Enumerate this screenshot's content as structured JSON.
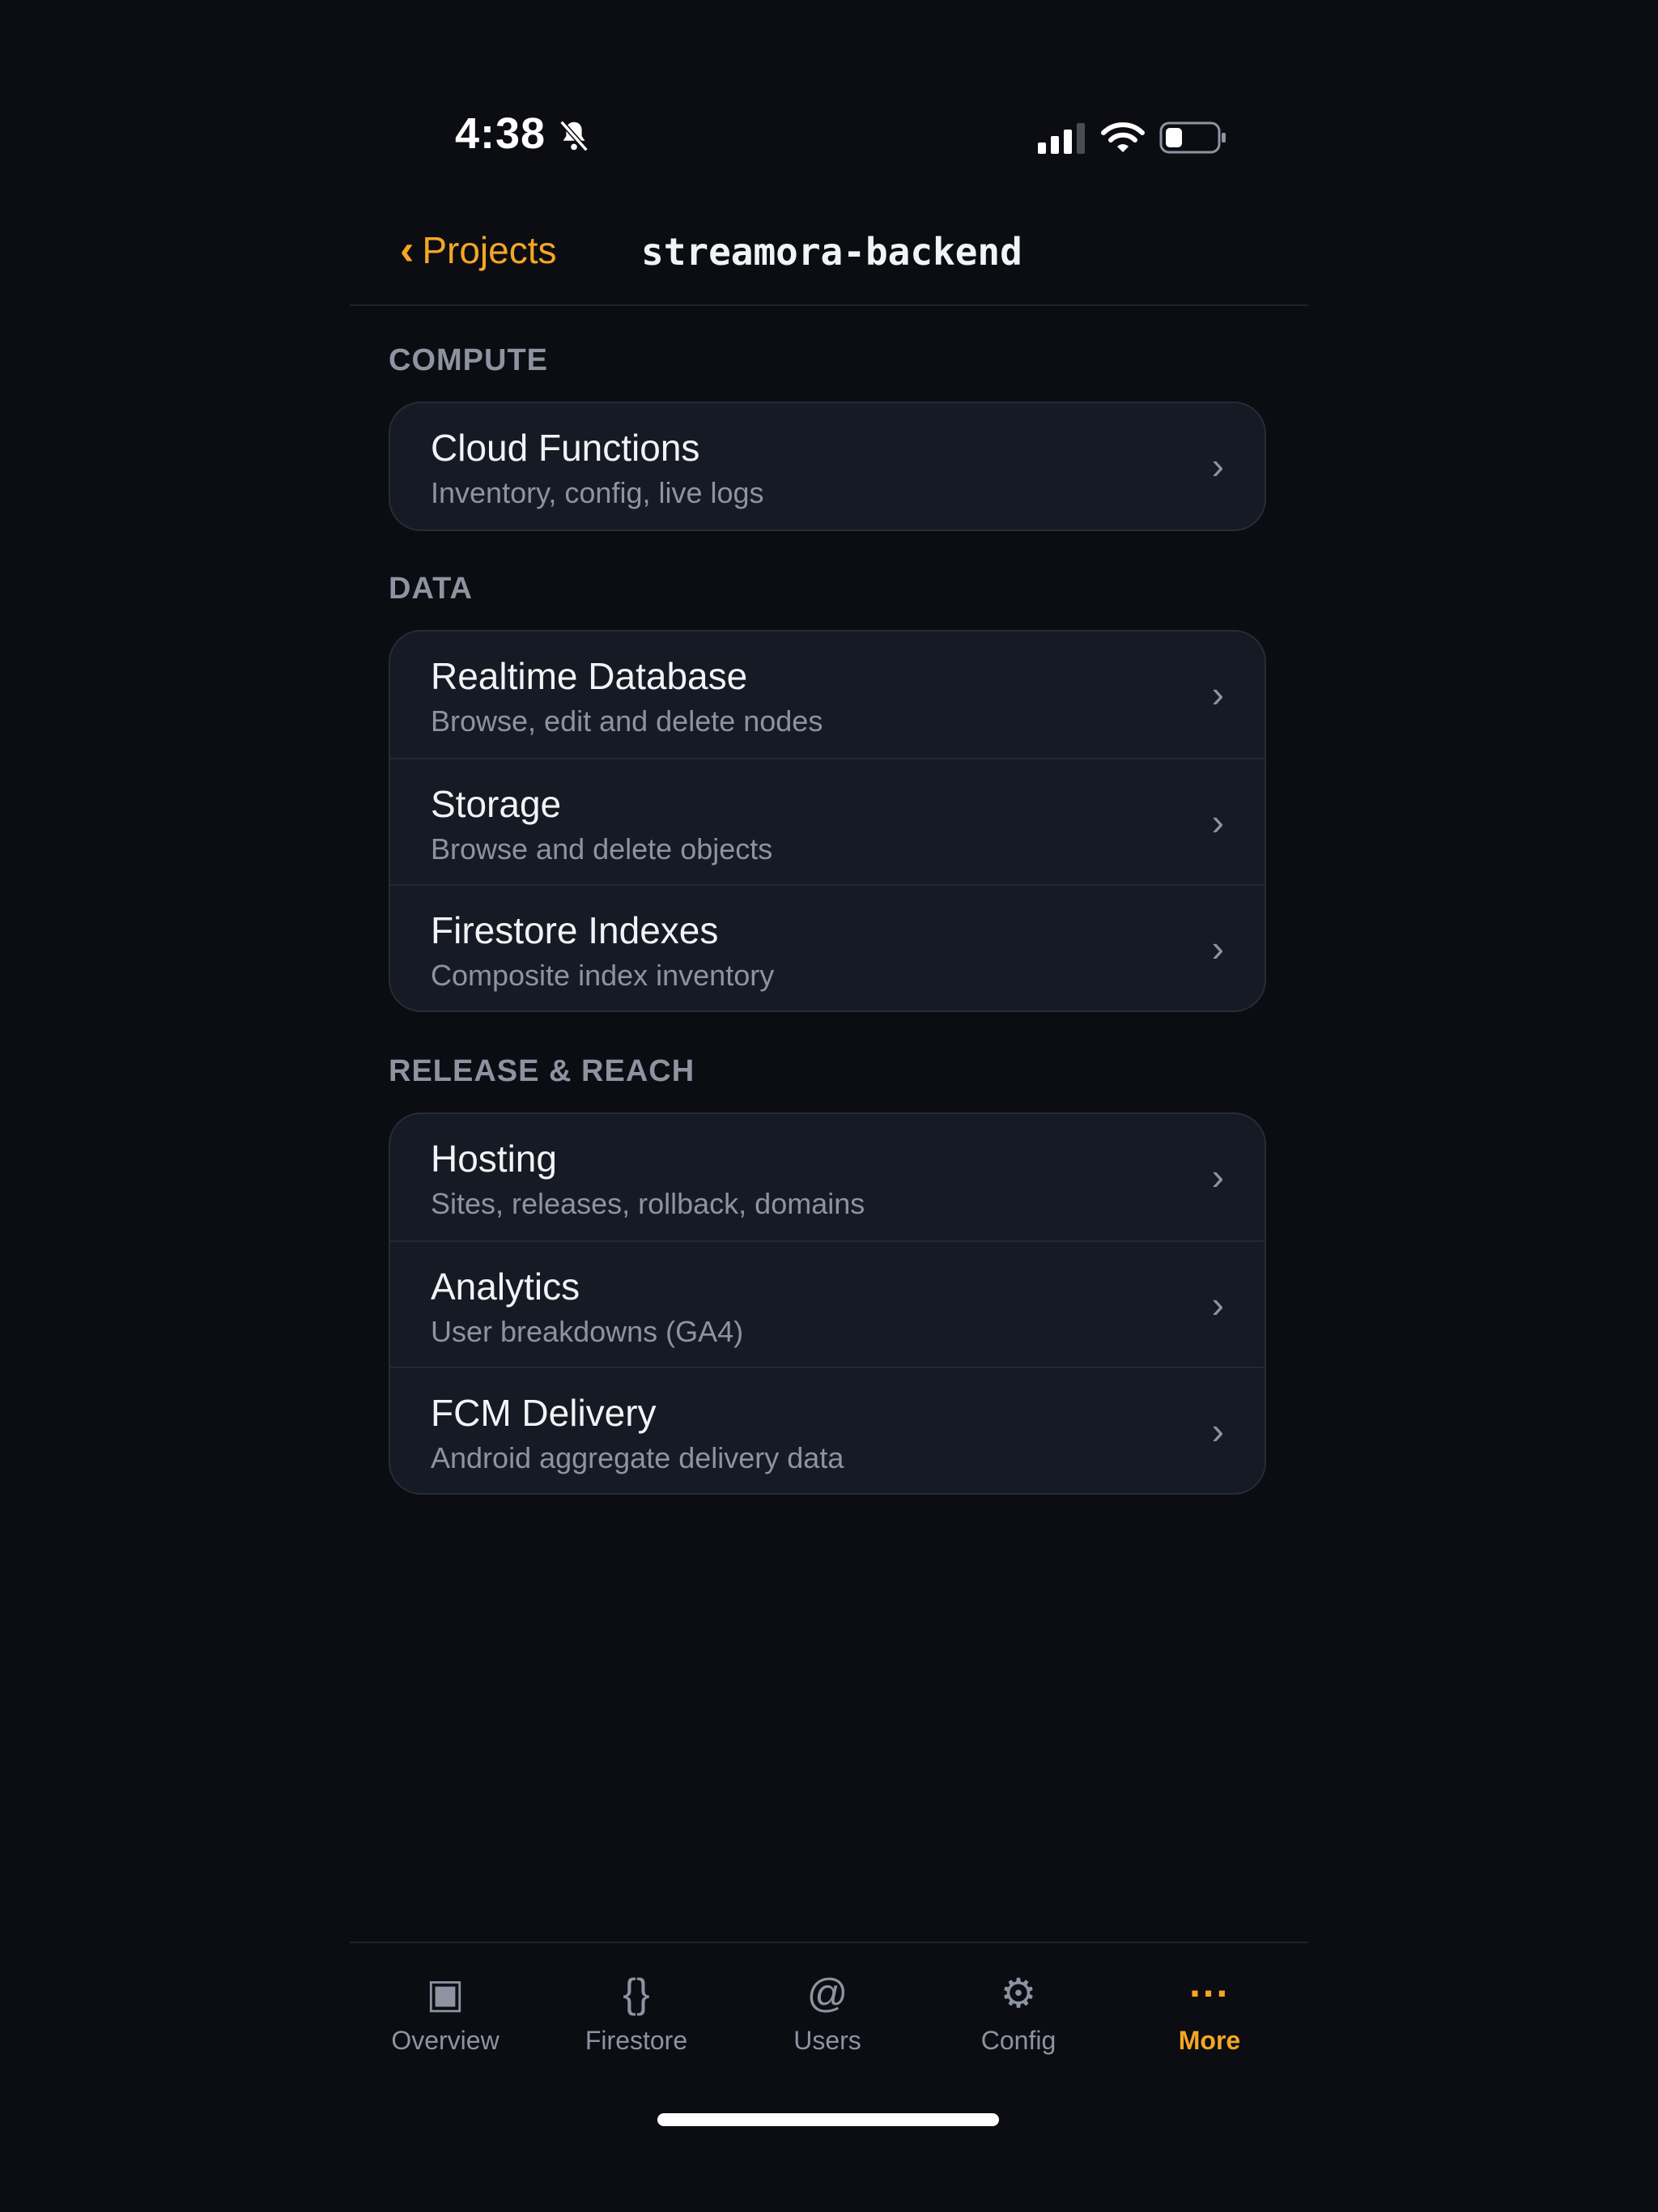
{
  "status_bar": {
    "time": "4:38",
    "icons": [
      "bell-slash-icon",
      "cellular-signal-icon",
      "wifi-icon",
      "battery-icon"
    ]
  },
  "nav": {
    "back_label": "Projects",
    "title": "streamora-backend"
  },
  "sections": [
    {
      "header": "COMPUTE",
      "items": [
        {
          "title": "Cloud Functions",
          "subtitle": "Inventory, config, live logs"
        }
      ]
    },
    {
      "header": "DATA",
      "items": [
        {
          "title": "Realtime Database",
          "subtitle": "Browse, edit and delete nodes"
        },
        {
          "title": "Storage",
          "subtitle": "Browse and delete objects"
        },
        {
          "title": "Firestore Indexes",
          "subtitle": "Composite index inventory"
        }
      ]
    },
    {
      "header": "RELEASE & REACH",
      "items": [
        {
          "title": "Hosting",
          "subtitle": "Sites, releases, rollback, domains"
        },
        {
          "title": "Analytics",
          "subtitle": "User breakdowns (GA4)"
        },
        {
          "title": "FCM Delivery",
          "subtitle": "Android aggregate delivery data"
        }
      ]
    }
  ],
  "tabs": [
    {
      "label": "Overview",
      "icon": "▣",
      "icon_name": "overview-icon"
    },
    {
      "label": "Firestore",
      "icon": "{}",
      "icon_name": "braces-icon"
    },
    {
      "label": "Users",
      "icon": "@",
      "icon_name": "at-sign-icon"
    },
    {
      "label": "Config",
      "icon": "⚙",
      "icon_name": "gear-icon"
    },
    {
      "label": "More",
      "icon": "···",
      "icon_name": "ellipsis-icon"
    }
  ],
  "active_tab": "More",
  "colors": {
    "accent": "#f5a623",
    "background": "#0b0d13",
    "card": "#161a24",
    "secondary_text": "#8d93a0"
  }
}
